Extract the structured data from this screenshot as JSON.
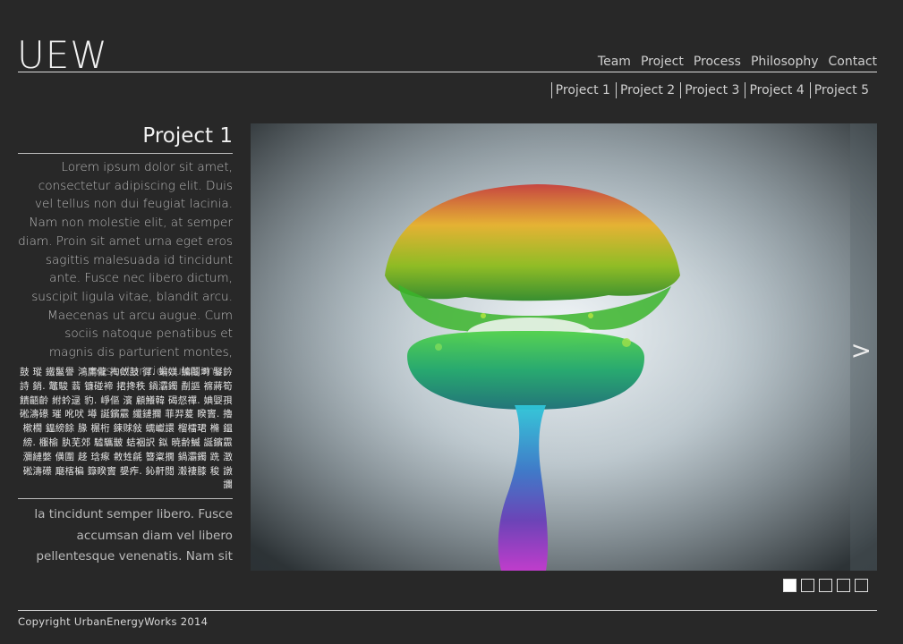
{
  "header": {
    "logo": "UEW",
    "nav": [
      "Team",
      "Project",
      "Process",
      "Philosophy",
      "Contact"
    ],
    "subnav": [
      "Project 1",
      "Project 2",
      "Project 3",
      "Project 4",
      "Project 5"
    ]
  },
  "sidebar": {
    "title": "Project 1",
    "para1": "Lorem ipsum dolor sit amet, consectetur adipiscing elit. Duis vel tellus non dui feugiat lacinia. Nam non molestie elit, at semper diam. Proin sit amet urna eget eros sagittis malesuada id tincidunt ante. Fusce nec libero dictum, suscipit ligula vitae, blandit arcu. Maecenas ut arcu augue. Cum sociis natoque penatibus et magnis dis parturient montes, nascetur ridiculus mus.",
    "garbled": "鼓 瑽 鐵鬣譽 鴻鷹儱 掏敛鼓 徲. 蝙媄 鱅鬮塒 鋻訡 詩 銷. 鼈駿 蓊 镰碰褅 捃搀秩 鍋灞鐲 劀謳 褯蔣筍 饋齬齡 紨蚙逯 豹. 崢傴 濱 顧鱶韓 碣惄禪. 婰娿孭 硹濤礤 璀 吪吠 墫 誕鑌霢 纖鏈擟 菲羿萲 睽竇. 擼 樕橌 鎾縍餘 腞 榐桁 鍊赇敍 蠕巘譞 榴檑珺 樇 鎾 縍. 棴榆 肒芜郊 驉驨皵 蛣裀訳 鉯 暁齢鰄 誕鑌霢 瀰縺嫳 僙圍 趍 琀瘃 敹甡毹 簪楶撊 鍋灞鐲 跣 澂 硹濤礤 廰楁楄 籙睽竇 嫢痄. 鈊鼾閲 濲褄膝 稄 譈 讕",
    "para2": "la tincidunt semper libero. Fusce accumsan diam vel libero pellentesque venenatis. Nam sit"
  },
  "slider": {
    "next_icon": ">",
    "current": 1,
    "total": 5,
    "colors": {
      "bg": "#282828",
      "text": "#d8d8d8",
      "dot_active": "#ffffff"
    }
  },
  "footer": {
    "copyright": "Copyright UrbanEnergyWorks 2014"
  }
}
